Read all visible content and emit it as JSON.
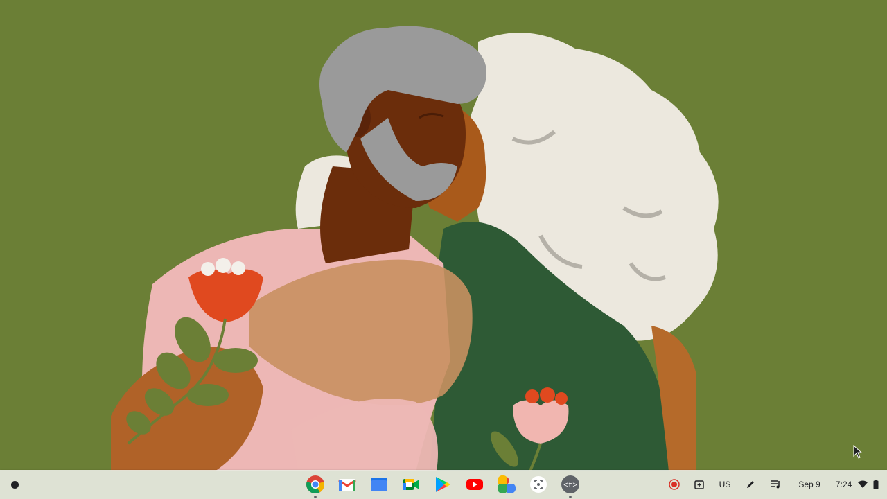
{
  "wallpaper": {
    "name": "wallpaper-embracing-couple",
    "background_color": "#6b7f36"
  },
  "shelf": {
    "launcher_icon": "launcher-icon",
    "apps": [
      {
        "name": "Chrome",
        "icon": "chrome-icon"
      },
      {
        "name": "Gmail",
        "icon": "gmail-icon"
      },
      {
        "name": "Files",
        "icon": "files-icon"
      },
      {
        "name": "Google Meet",
        "icon": "meet-icon"
      },
      {
        "name": "Play Store",
        "icon": "play-store-icon"
      },
      {
        "name": "YouTube",
        "icon": "youtube-icon"
      },
      {
        "name": "Google Photos",
        "icon": "photos-icon"
      },
      {
        "name": "Screen Capture",
        "icon": "screen-capture-icon"
      },
      {
        "name": "Terminal",
        "icon": "terminal-icon"
      }
    ],
    "tray": {
      "recording_icon": "record-icon",
      "clipboard_icon": "holding-space-icon",
      "ime_label": "US",
      "stylus_icon": "stylus-icon",
      "media_icon": "media-controls-icon",
      "date": "Sep 9",
      "time": "7:24",
      "wifi_icon": "wifi-icon",
      "battery_icon": "battery-icon"
    }
  },
  "colors": {
    "shelf_bg": "#e8eae2",
    "record_red": "#d93025"
  }
}
